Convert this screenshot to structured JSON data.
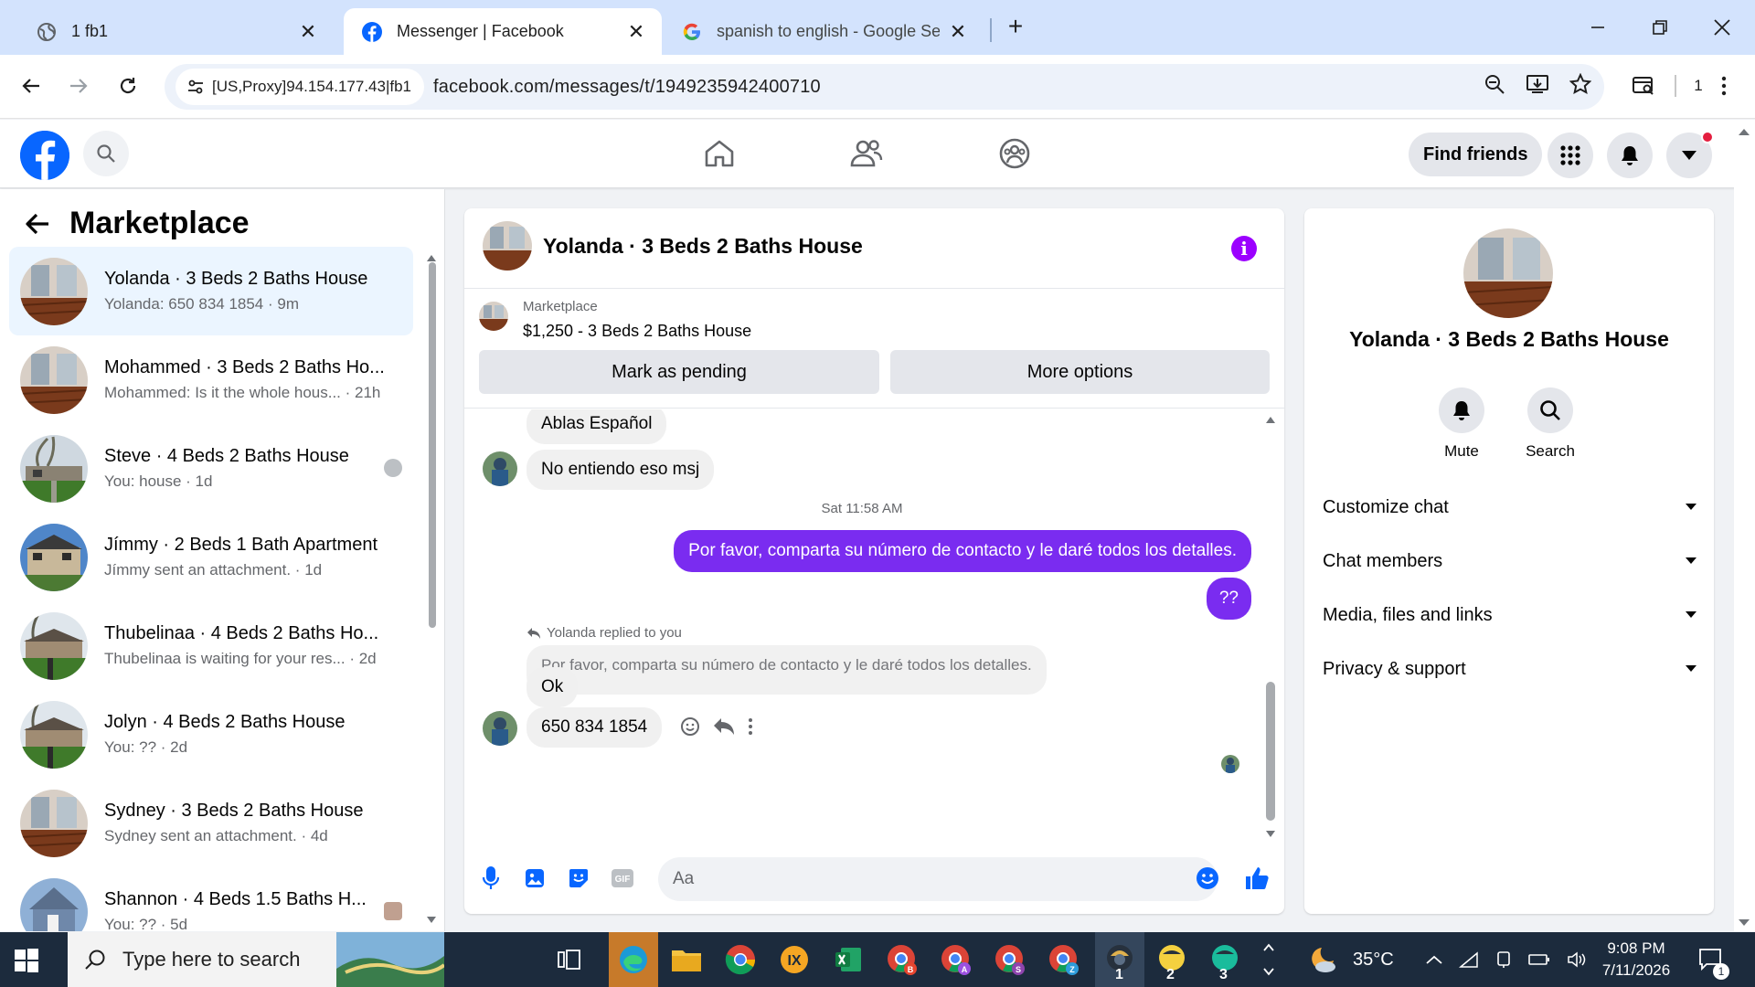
{
  "browser": {
    "tabs": [
      {
        "title": "1 fb1",
        "close": "✕"
      },
      {
        "title": "Messenger | Facebook",
        "close": "✕"
      },
      {
        "title": "spanish to english - Google Sear",
        "close": "✕"
      }
    ],
    "new_tab": "+",
    "proxy_chip": "[US,Proxy]94.154.177.43|fb1",
    "url": "facebook.com/messages/t/1949235942400710",
    "extension_count": "1"
  },
  "fb_header": {
    "find_friends": "Find friends"
  },
  "left_panel": {
    "title": "Marketplace",
    "conversations": [
      {
        "name": "Yolanda · 3 Beds 2 Baths House",
        "preview": "Yolanda: 650 834 1854 · 9m"
      },
      {
        "name": "Mohammed · 3 Beds 2 Baths Ho...",
        "preview": "Mohammed: Is it the whole hous... · 21h"
      },
      {
        "name": "Steve · 4 Beds 2 Baths House",
        "preview": "You: house · 1d"
      },
      {
        "name": "Jímmy · 2 Beds 1 Bath Apartment",
        "preview": "Jímmy sent an attachment. · 1d"
      },
      {
        "name": "Thubelinaa · 4 Beds 2 Baths Ho...",
        "preview": "Thubelinaa is waiting for your res... · 2d"
      },
      {
        "name": "Jolyn · 4 Beds 2 Baths House",
        "preview": "You: ?? · 2d"
      },
      {
        "name": "Sydney · 3 Beds 2 Baths House",
        "preview": "Sydney sent an attachment. · 4d"
      },
      {
        "name": "Shannon · 4 Beds 1.5 Baths H...",
        "preview": "You: ?? · 5d"
      }
    ]
  },
  "chat": {
    "title": "Yolanda · 3 Beds 2 Baths House",
    "listing_source": "Marketplace",
    "listing_price": "$1,250 - 3 Beds 2 Baths House",
    "mark_pending": "Mark as pending",
    "more_options": "More options",
    "messages": {
      "in1": "Ablas Español",
      "in2": "No entiendo eso msj",
      "timestamp": "Sat 11:58 AM",
      "out1": "Por favor, comparta su número de contacto y le daré todos los detalles.",
      "out2": "??",
      "reply_note": "Yolanda replied to you",
      "quoted": "Por favor, comparta su número de contacto y le daré todos los detalles.",
      "in3": "Ok",
      "in4": "650 834 1854"
    },
    "composer_placeholder": "Aa"
  },
  "right_panel": {
    "name": "Yolanda · 3 Beds 2 Baths House",
    "mute": "Mute",
    "search": "Search",
    "sections": [
      "Customize chat",
      "Chat members",
      "Media, files and links",
      "Privacy & support"
    ]
  },
  "taskbar": {
    "search_placeholder": "Type here to search",
    "weather": "35°C",
    "time": "9:08 PM",
    "date": "7/11/2026",
    "notification_count": "1",
    "app_badges": [
      "1",
      "2",
      "3"
    ]
  },
  "colors": {
    "fb_blue": "#0866ff",
    "messenger_purple": "#7a2cf0",
    "selected_row": "#ebf5ff",
    "taskbar": "#1c2b3d"
  }
}
